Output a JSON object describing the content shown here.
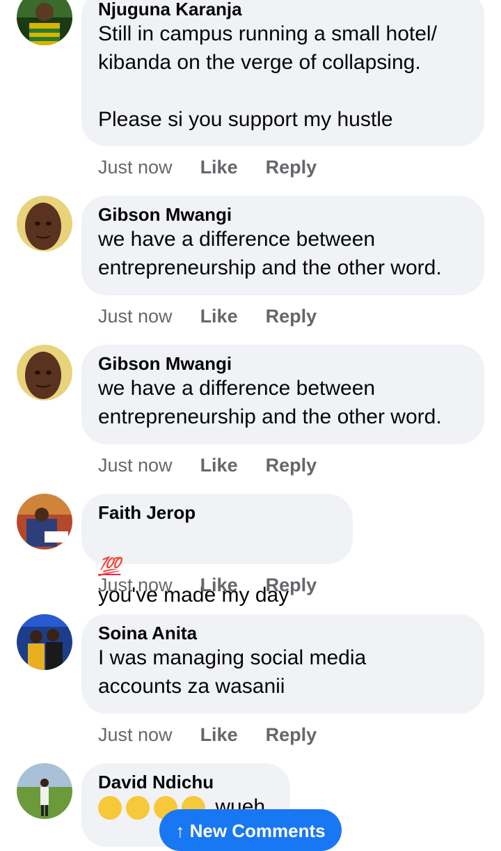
{
  "comments": [
    {
      "author": "Njuguna Karanja",
      "text": "Still in campus running a small hotel/\nkibanda on the verge of collapsing.\n\nPlease si you support my hustle",
      "time": "Just now",
      "like": "Like",
      "reply": "Reply",
      "avatar_icon": "person-avatar"
    },
    {
      "author": "Gibson Mwangi",
      "text": "we have a difference between\nentrepreneurship and the other word.",
      "time": "Just now",
      "like": "Like",
      "reply": "Reply",
      "avatar_icon": "person-avatar"
    },
    {
      "author": "Gibson Mwangi",
      "text": "we have a difference between\nentrepreneurship and the other word.",
      "time": "Just now",
      "like": "Like",
      "reply": "Reply",
      "avatar_icon": "person-avatar"
    },
    {
      "author": "Faith Jerop",
      "emoji": "💯",
      "text": "you've made my day",
      "time": "Just now",
      "like": "Like",
      "reply": "Reply",
      "avatar_icon": "person-avatar"
    },
    {
      "author": "Soina Anita",
      "text": "I was managing social media\naccounts za wasanii",
      "time": "Just now",
      "like": "Like",
      "reply": "Reply",
      "avatar_icon": "group-avatar"
    },
    {
      "author": "David Ndichu",
      "text": "wueh",
      "emoji_icon": "grinning-sweat-emoji",
      "avatar_icon": "person-avatar"
    }
  ],
  "new_comments_pill": {
    "label": "↑ New Comments",
    "color": "#1877f2"
  },
  "colors": {
    "bubble": "#f0f2f5",
    "meta": "#65676b",
    "text": "#050505"
  }
}
